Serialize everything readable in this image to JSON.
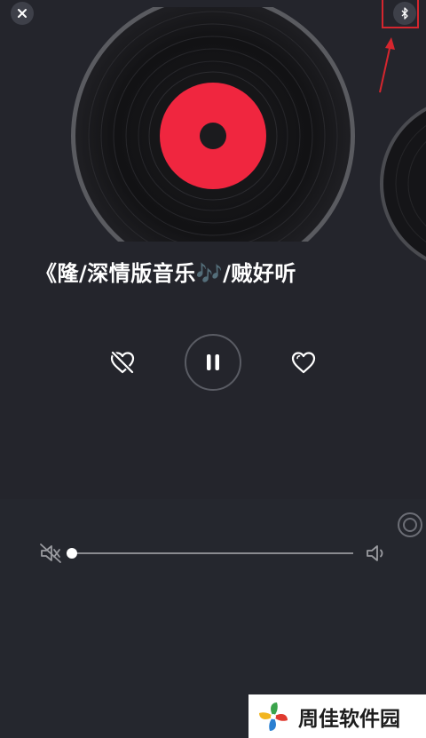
{
  "header": {
    "close_icon": "close-icon",
    "bluetooth_icon": "bluetooth-icon"
  },
  "player": {
    "song_title": "《隆/深情版音乐🎶/贼好听",
    "state": "playing",
    "controls": {
      "dislike_icon": "heart-slash-icon",
      "pause_icon": "pause-icon",
      "like_icon": "heart-icon"
    }
  },
  "volume": {
    "level": 0,
    "mute_icon": "volume-mute-icon",
    "up_icon": "volume-up-icon"
  },
  "watermark": {
    "text": "周佳软件园"
  },
  "colors": {
    "background": "#24252c",
    "record_label": "#f0263f",
    "annotation": "#d5262e"
  }
}
